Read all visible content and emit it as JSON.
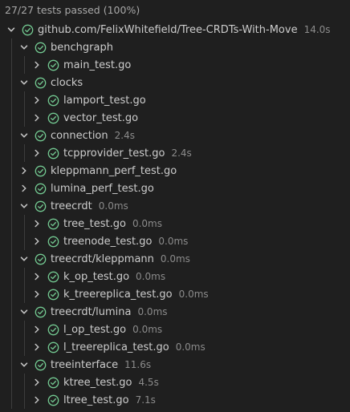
{
  "header": {
    "summary": "27/27 tests passed (100%)"
  },
  "colors": {
    "pass": "#73c991",
    "guide": "#3d3d3d",
    "background": "#1f1f1f"
  },
  "icons": {
    "expanded": "chevron-down-icon",
    "collapsed": "chevron-right-icon",
    "status": "passed-check-icon"
  },
  "tests": [
    {
      "label": "github.com/FelixWhitefield/Tree-CRDTs-With-Move",
      "duration": "14.0s",
      "depth": 0,
      "expanded": true
    },
    {
      "label": "benchgraph",
      "duration": "",
      "depth": 1,
      "expanded": true
    },
    {
      "label": "main_test.go",
      "duration": "",
      "depth": 2,
      "expanded": false
    },
    {
      "label": "clocks",
      "duration": "",
      "depth": 1,
      "expanded": true
    },
    {
      "label": "lamport_test.go",
      "duration": "",
      "depth": 2,
      "expanded": false
    },
    {
      "label": "vector_test.go",
      "duration": "",
      "depth": 2,
      "expanded": false
    },
    {
      "label": "connection",
      "duration": "2.4s",
      "depth": 1,
      "expanded": true
    },
    {
      "label": "tcpprovider_test.go",
      "duration": "2.4s",
      "depth": 2,
      "expanded": false
    },
    {
      "label": "kleppmann_perf_test.go",
      "duration": "",
      "depth": 1,
      "expanded": false
    },
    {
      "label": "lumina_perf_test.go",
      "duration": "",
      "depth": 1,
      "expanded": false
    },
    {
      "label": "treecrdt",
      "duration": "0.0ms",
      "depth": 1,
      "expanded": true
    },
    {
      "label": "tree_test.go",
      "duration": "0.0ms",
      "depth": 2,
      "expanded": false
    },
    {
      "label": "treenode_test.go",
      "duration": "0.0ms",
      "depth": 2,
      "expanded": false
    },
    {
      "label": "treecrdt/kleppmann",
      "duration": "0.0ms",
      "depth": 1,
      "expanded": true
    },
    {
      "label": "k_op_test.go",
      "duration": "0.0ms",
      "depth": 2,
      "expanded": false
    },
    {
      "label": "k_treereplica_test.go",
      "duration": "0.0ms",
      "depth": 2,
      "expanded": false
    },
    {
      "label": "treecrdt/lumina",
      "duration": "0.0ms",
      "depth": 1,
      "expanded": true
    },
    {
      "label": "l_op_test.go",
      "duration": "0.0ms",
      "depth": 2,
      "expanded": false
    },
    {
      "label": "l_treereplica_test.go",
      "duration": "0.0ms",
      "depth": 2,
      "expanded": false
    },
    {
      "label": "treeinterface",
      "duration": "11.6s",
      "depth": 1,
      "expanded": true
    },
    {
      "label": "ktree_test.go",
      "duration": "4.5s",
      "depth": 2,
      "expanded": false
    },
    {
      "label": "ltree_test.go",
      "duration": "7.1s",
      "depth": 2,
      "expanded": false
    }
  ]
}
